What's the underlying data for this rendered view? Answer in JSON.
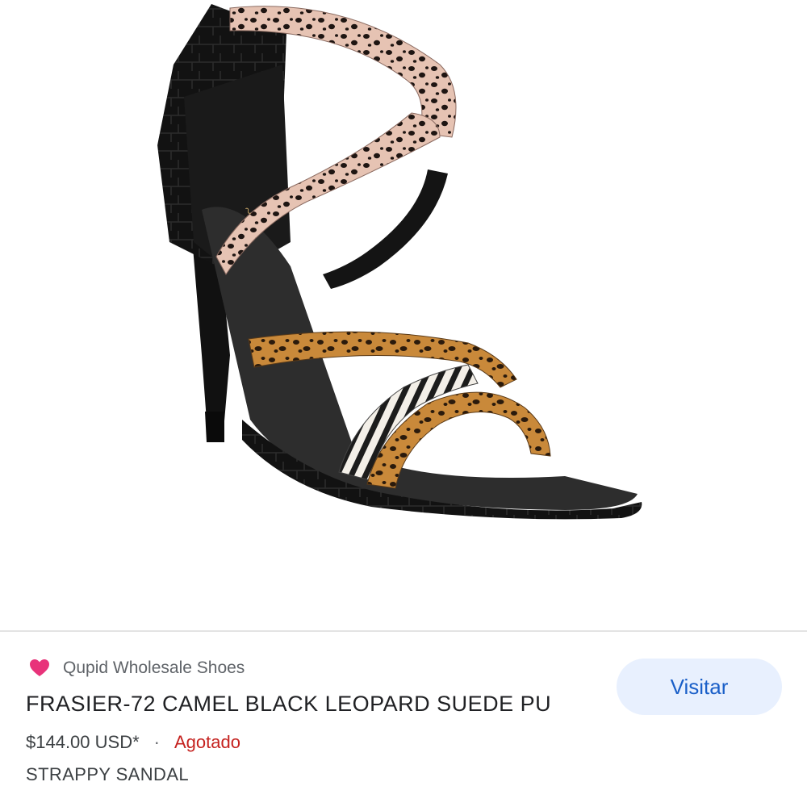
{
  "product_image": {
    "alt_icon": "strappy-sandal-photo"
  },
  "listing": {
    "store_name": "Qupid Wholesale Shoes",
    "store_icon": "pink-heart-icon",
    "title": "FRASIER-72 CAMEL BLACK LEOPARD SUEDE PU",
    "price": "$144.00 USD*",
    "separator": "·",
    "availability": "Agotado",
    "subtitle": "STRAPPY SANDAL",
    "visit_label": "Visitar"
  },
  "colors": {
    "accent_blue": "#1a5fc8",
    "button_bg": "#e8f0fe",
    "status_red": "#c5221f",
    "heart_pink": "#e8337a"
  }
}
